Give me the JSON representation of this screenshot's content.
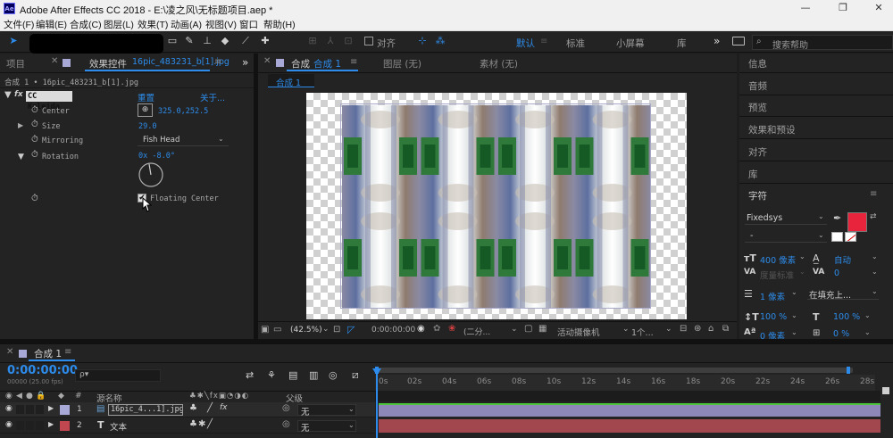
{
  "window": {
    "app_icon": "Ae",
    "title": "Adobe After Effects CC 2018 - E:\\凌之风\\无标题项目.aep *",
    "controls": [
      "minimize-icon",
      "restore-icon",
      "close-icon"
    ]
  },
  "menu": [
    "文件(F)",
    "编辑(E)",
    "合成(C)",
    "图层(L)",
    "效果(T)",
    "动画(A)",
    "视图(V)",
    "窗口",
    "帮助(H)"
  ],
  "toolbar": {
    "align_label": "对齐",
    "workspaces": [
      "默认",
      "标准",
      "小屏幕",
      "库"
    ],
    "active_workspace": "默认",
    "search_placeholder": "搜索帮助"
  },
  "left_panel": {
    "tab_project": "项目",
    "tab_effects": "效果控件",
    "tab_effects_file": "16pic_483231_b[1].jpg",
    "breadcrumb": "合成 1 • 16pic_483231_b[1].jpg",
    "effect_name": "CC Kaleida",
    "reset_label": "重置",
    "about_label": "关于...",
    "props": {
      "center_label": "Center",
      "center_value": "325.0,252.5",
      "size_label": "Size",
      "size_value": "29.0",
      "mirroring_label": "Mirroring",
      "mirroring_value": "Fish Head",
      "rotation_label": "Rotation",
      "rotation_value": "0x -8.0°",
      "floating_label": "Floating Center"
    }
  },
  "comp_panel": {
    "tab_comp_prefix": "合成",
    "tab_comp_name": "合成 1",
    "tab_layer": "图层 (无)",
    "tab_footage": "素材 (无)",
    "subtab": "合成 1",
    "zoom": "(42.5%)",
    "timecode": "0:00:00:00",
    "resolution": "(二分...",
    "camera": "活动摄像机",
    "views": "1个..."
  },
  "right_panel": {
    "items": [
      "信息",
      "音频",
      "预览",
      "效果和预设",
      "对齐",
      "库"
    ],
    "char_title": "字符",
    "font_name": "Fixedsys",
    "font_style": "-",
    "fill_color": "#e8243c",
    "font_size": "400 像素",
    "leading": "自动",
    "kerning": "度量标准",
    "tracking": "0",
    "stroke_width": "1 像素",
    "stroke_mode": "在填充上...",
    "vscale": "100 %",
    "hscale": "100 %",
    "baseline": "0 像素",
    "tsume": "0 %"
  },
  "timeline": {
    "tab": "合成 1",
    "timecode": "0:00:00:00",
    "frame_info": "00000 (25.00 fps)",
    "search_placeholder": "ρ▾",
    "col_hash": "#",
    "col_source": "源名称",
    "col_parent": "父级",
    "ruler": [
      "0s",
      "02s",
      "04s",
      "06s",
      "08s",
      "10s",
      "12s",
      "14s",
      "16s",
      "18s",
      "20s",
      "22s",
      "24s",
      "26s",
      "28s"
    ],
    "layers": [
      {
        "num": "1",
        "name": "16pic_4...1].jpg",
        "parent": "无",
        "label_color": "#a9a9d8",
        "bar_color": "#8d88b8"
      },
      {
        "num": "2",
        "name": "文本",
        "parent": "无",
        "label_color": "#c0464f",
        "bar_color": "#a3474e"
      }
    ]
  }
}
